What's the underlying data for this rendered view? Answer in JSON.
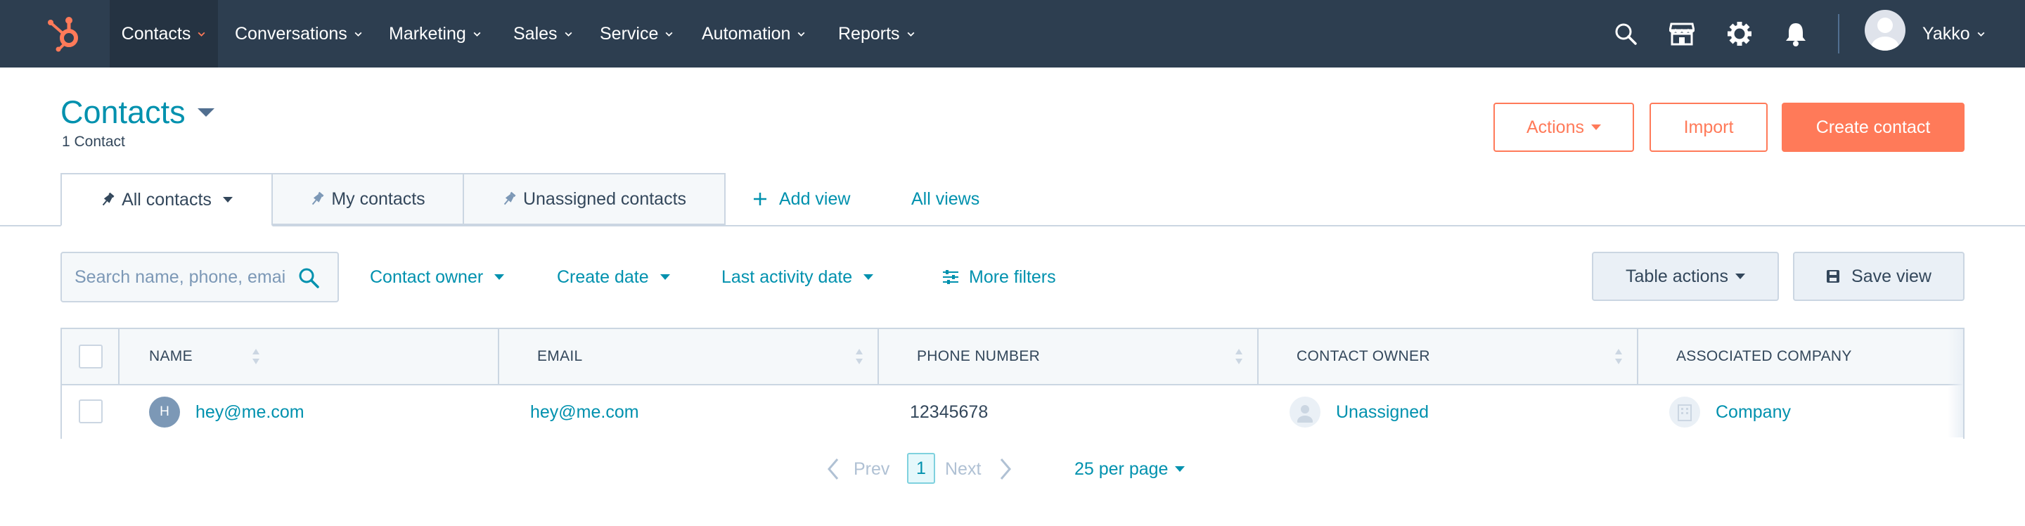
{
  "colors": {
    "nav_bg": "#2d3e50",
    "accent_orange": "#ff7a59",
    "link_teal": "#0091ae",
    "text_dark": "#33475b",
    "border": "#cbd6e2"
  },
  "nav": {
    "logo": "hubspot-logo",
    "items": [
      {
        "label": "Contacts",
        "active": true
      },
      {
        "label": "Conversations"
      },
      {
        "label": "Marketing"
      },
      {
        "label": "Sales"
      },
      {
        "label": "Service"
      },
      {
        "label": "Automation"
      },
      {
        "label": "Reports"
      }
    ],
    "icons": [
      "search-icon",
      "marketplace-icon",
      "settings-gear-icon",
      "notifications-bell-icon"
    ],
    "user": {
      "name": "Yakko",
      "avatar": "default-user-avatar"
    }
  },
  "header": {
    "title": "Contacts",
    "record_count": "1 Contact",
    "buttons": {
      "actions": "Actions",
      "import": "Import",
      "create": "Create contact"
    }
  },
  "views": {
    "tabs": [
      {
        "label": "All contacts",
        "active": true,
        "pinned": true,
        "has_menu": true
      },
      {
        "label": "My contacts",
        "pinned": true
      },
      {
        "label": "Unassigned contacts",
        "pinned": true
      }
    ],
    "add_view": "Add view",
    "all_views": "All views"
  },
  "filters": {
    "search_placeholder": "Search name, phone, email",
    "items": [
      "Contact owner",
      "Create date",
      "Last activity date"
    ],
    "more_filters": "More filters",
    "table_actions": "Table actions",
    "save_view": "Save view"
  },
  "table": {
    "columns": [
      "NAME",
      "EMAIL",
      "PHONE NUMBER",
      "CONTACT OWNER",
      "ASSOCIATED COMPANY"
    ],
    "rows": [
      {
        "avatar_initial": "H",
        "name": "hey@me.com",
        "email": "hey@me.com",
        "phone": "12345678",
        "owner": "Unassigned",
        "company": "Company"
      }
    ]
  },
  "pagination": {
    "prev": "Prev",
    "current_page": "1",
    "next": "Next",
    "per_page": "25 per page"
  }
}
